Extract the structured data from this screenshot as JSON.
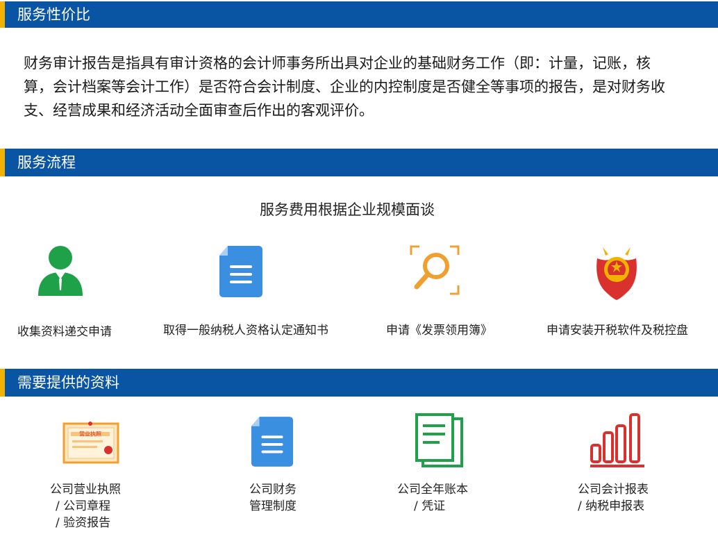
{
  "sections": {
    "price": {
      "title": "服务性价比"
    },
    "process": {
      "title": "服务流程"
    },
    "materials": {
      "title": "需要提供的资料"
    }
  },
  "intro": {
    "text": "财务审计报告是指具有审计资格的会计师事务所出具对企业的基础财务工作（即：计量，记账，核算，会计档案等会计工作）是否符合会计制度、企业的内控制度是否健全等事项的报告，是对财务收支、经营成果和经济活动全面审查后作出的客观评价。"
  },
  "process": {
    "fee_note": "服务费用根据企业规模面谈",
    "steps": [
      {
        "label": "收集资料递交申请",
        "icon": "person-icon"
      },
      {
        "label": "取得一般纳税人资格认定通知书",
        "icon": "document-icon"
      },
      {
        "label": "申请《发票领用簿》",
        "icon": "search-icon"
      },
      {
        "label": "申请安装开税软件及税控盘",
        "icon": "emblem-icon"
      }
    ]
  },
  "materials": {
    "items": [
      {
        "line1": "公司营业执照",
        "line2": "/  公司章程",
        "line3": "/  验资报告",
        "icon": "certificate-icon",
        "badge": "营业执照"
      },
      {
        "line1": "公司财务",
        "line2": "管理制度",
        "icon": "document-icon"
      },
      {
        "line1": "公司全年账本",
        "line2": "/  凭证",
        "icon": "ledger-icon"
      },
      {
        "line1": "公司会计报表",
        "line2": "/ 纳税申报表",
        "icon": "bar-chart-icon"
      }
    ]
  },
  "colors": {
    "bar": "#0a55a3",
    "accent": "#f2b300",
    "green": "#1fa14a",
    "blue": "#3a8fe0",
    "orange": "#f0a030",
    "red": "#d9322e"
  }
}
